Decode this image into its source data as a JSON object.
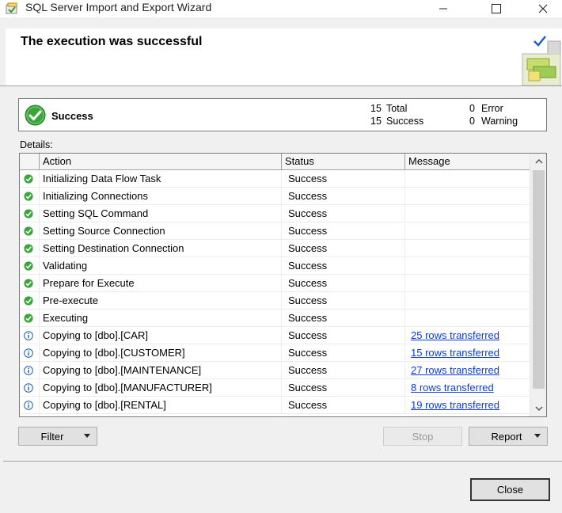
{
  "window": {
    "title": "SQL Server Import and Export Wizard",
    "app_icon": "wizard-app-icon",
    "minimize_icon": "minimize-icon",
    "maximize_icon": "maximize-icon",
    "close_icon": "close-icon"
  },
  "header": {
    "title": "The execution was successful",
    "graphic_icon": "wizard-success-graphic"
  },
  "summary": {
    "status_icon": "success-check-icon",
    "title": "Success",
    "total_count": "15",
    "total_label": "Total",
    "success_count": "15",
    "success_label": "Success",
    "error_count": "0",
    "error_label": "Error",
    "warning_count": "0",
    "warning_label": "Warning"
  },
  "details": {
    "label": "Details:",
    "columns": [
      "Action",
      "Status",
      "Message"
    ],
    "rows": [
      {
        "icon": "success",
        "action": "Initializing Data Flow Task",
        "status": "Success",
        "message": ""
      },
      {
        "icon": "success",
        "action": "Initializing Connections",
        "status": "Success",
        "message": ""
      },
      {
        "icon": "success",
        "action": "Setting SQL Command",
        "status": "Success",
        "message": ""
      },
      {
        "icon": "success",
        "action": "Setting Source Connection",
        "status": "Success",
        "message": ""
      },
      {
        "icon": "success",
        "action": "Setting Destination Connection",
        "status": "Success",
        "message": ""
      },
      {
        "icon": "success",
        "action": "Validating",
        "status": "Success",
        "message": ""
      },
      {
        "icon": "success",
        "action": "Prepare for Execute",
        "status": "Success",
        "message": ""
      },
      {
        "icon": "success",
        "action": "Pre-execute",
        "status": "Success",
        "message": ""
      },
      {
        "icon": "success",
        "action": "Executing",
        "status": "Success",
        "message": ""
      },
      {
        "icon": "info",
        "action": "Copying to [dbo].[CAR]",
        "status": "Success",
        "message": "25 rows transferred"
      },
      {
        "icon": "info",
        "action": "Copying to [dbo].[CUSTOMER]",
        "status": "Success",
        "message": "15 rows transferred"
      },
      {
        "icon": "info",
        "action": "Copying to [dbo].[MAINTENANCE]",
        "status": "Success",
        "message": "27 rows transferred"
      },
      {
        "icon": "info",
        "action": "Copying to [dbo].[MANUFACTURER]",
        "status": "Success",
        "message": "8 rows transferred"
      },
      {
        "icon": "info",
        "action": "Copying to [dbo].[RENTAL]",
        "status": "Success",
        "message": "19 rows transferred"
      }
    ]
  },
  "buttons": {
    "filter": "Filter",
    "stop": "Stop",
    "report": "Report",
    "close": "Close"
  },
  "colors": {
    "success_green": "#3aa53a",
    "info_blue": "#1a5fb4",
    "link": "#0b3cd6"
  }
}
